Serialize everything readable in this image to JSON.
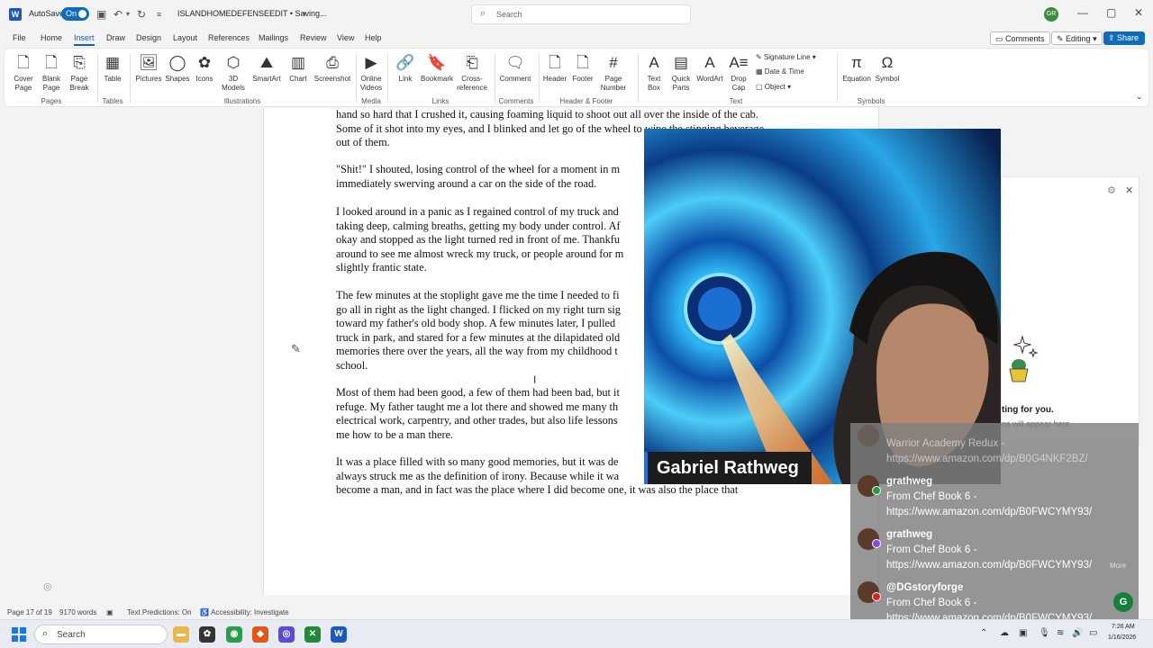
{
  "titlebar": {
    "autosave_label": "AutoSave",
    "autosave_state": "On",
    "document_title": "ISLANDHOMEDEFENSEEDIT • Saving...",
    "search_placeholder": "Search",
    "user_initials": "GR"
  },
  "tabs": [
    {
      "label": "File"
    },
    {
      "label": "Home"
    },
    {
      "label": "Insert"
    },
    {
      "label": "Draw"
    },
    {
      "label": "Design"
    },
    {
      "label": "Layout"
    },
    {
      "label": "References"
    },
    {
      "label": "Mailings"
    },
    {
      "label": "Review"
    },
    {
      "label": "View"
    },
    {
      "label": "Help"
    }
  ],
  "active_tab": "Insert",
  "header_actions": {
    "comments": "Comments",
    "editing": "Editing",
    "share": "Share"
  },
  "ribbon": {
    "cover_page": "Cover Page",
    "blank_page": "Blank Page",
    "page_break": "Page Break",
    "table": "Table",
    "pictures": "Pictures",
    "shapes": "Shapes",
    "icons": "Icons",
    "models3d": "3D Models",
    "smartart": "SmartArt",
    "chart": "Chart",
    "screenshot": "Screenshot",
    "online_videos": "Online Videos",
    "link": "Link",
    "bookmark": "Bookmark",
    "cross_reference": "Cross-reference",
    "comment": "Comment",
    "header": "Header",
    "footer": "Footer",
    "page_number": "Page Number",
    "text_box": "Text Box",
    "quick_parts": "Quick Parts",
    "wordart": "WordArt",
    "drop_cap": "Drop Cap",
    "signature_line": "Signature Line",
    "date_time": "Date & Time",
    "object": "Object",
    "equation": "Equation",
    "symbol": "Symbol",
    "groups": {
      "pages": "Pages",
      "tables": "Tables",
      "illustrations": "Illustrations",
      "media": "Media",
      "links": "Links",
      "comments": "Comments",
      "header_footer": "Header & Footer",
      "text": "Text",
      "symbols": "Symbols"
    }
  },
  "document": {
    "paragraphs": [
      {
        "lines": [
          "hand so hard that I crushed it, causing foaming liquid to shoot out all over the inside of the cab.",
          "Some of it shot into my eyes, and I blinked and let go of the wheel to wipe the stinging beverage",
          "out of them."
        ]
      },
      {
        "lines": [
          "\"Shit!\" I shouted, losing control of the wheel for a moment in m",
          "immediately swerving around a car on the side of the road."
        ]
      },
      {
        "lines": [
          "I looked around in a panic as I regained control of my truck and",
          "taking deep, calming breaths, getting my body under control. Af",
          "okay and stopped as the light turned red in front of me. Thankfu",
          "around to see me almost wreck my truck, or people around for m",
          "slightly frantic state."
        ]
      },
      {
        "lines": [
          "The few minutes at the stoplight gave me the time I needed to fi",
          "go all in right as the light changed. I flicked on my right turn sig",
          "toward my father's old body shop. A few minutes later, I pulled",
          "truck in park, and stared for a few minutes at the dilapidated old",
          "memories there over the years, all the way from my childhood t",
          "school."
        ]
      },
      {
        "lines": [
          "Most of them had been good, a few of them had been bad, but it",
          "refuge. My father taught me a lot there and showed me many th",
          "electrical work, carpentry, and other trades, but also life lessons",
          "me how to be a man there."
        ]
      },
      {
        "lines": [
          "It was a place filled with so many good memories, but it was de",
          "always struck me as the definition of irony. Because while it wa",
          "become a man, and in fact was the place where I did become one, it was also the place that"
        ]
      }
    ]
  },
  "webcam": {
    "streamer_name": "Gabriel Rathweg"
  },
  "side_panel": {
    "title": "ting for you.",
    "subtitle": "ns will appear here."
  },
  "chat": {
    "messages": [
      {
        "user": "",
        "text": "Warrior Academy Redux -",
        "link": "https://www.amazon.com/dp/B0G4NKF2BZ/"
      },
      {
        "user": "grathweg",
        "text": "From Chef Book 6 -",
        "link": "https://www.amazon.com/dp/B0FWCYMY93/"
      },
      {
        "user": "grathweg",
        "text": "From Chef Book 6 -",
        "link": "https://www.amazon.com/dp/B0FWCYMY93/"
      },
      {
        "user": "@DGstoryforge",
        "text": "From Chef Book 6 -",
        "link": "https://www.amazon.com/dp/B0FWCYMY93/"
      }
    ],
    "more_label": "More"
  },
  "statusbar": {
    "page": "Page 17 of 19",
    "words": "9170 words",
    "text_predictions": "Text Predictions: On",
    "accessibility": "Accessibility: Investigate"
  },
  "taskbar": {
    "search_label": "Search",
    "time": "7:26 AM",
    "date": "1/16/2026"
  },
  "colors": {
    "accent": "#185abd",
    "share": "#0f6cbd",
    "page": "#ffffff",
    "chrome": "#f3f3f3"
  }
}
